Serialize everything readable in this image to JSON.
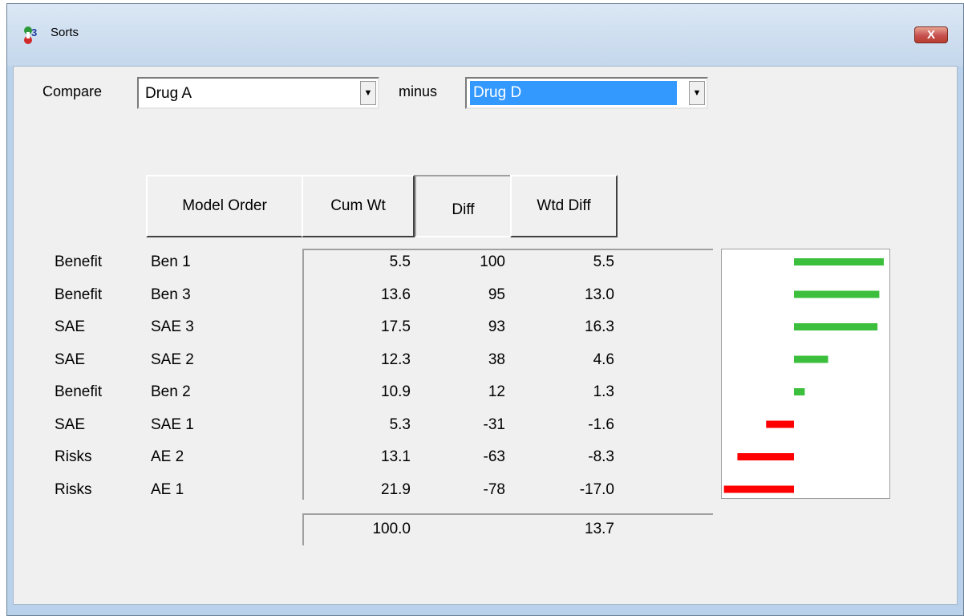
{
  "window": {
    "title": "Sorts",
    "close_glyph": "X"
  },
  "compare": {
    "label": "Compare",
    "left_value": "Drug A",
    "minus_label": "minus",
    "right_value": "Drug D",
    "dropdown_glyph": "▼"
  },
  "sort_buttons": [
    {
      "label": "Model Order",
      "state": "raised"
    },
    {
      "label": "Cum Wt",
      "state": "raised"
    },
    {
      "label": "Diff",
      "state": "pressed"
    },
    {
      "label": "Wtd Diff",
      "state": "raised"
    }
  ],
  "rows": [
    {
      "category": "Benefit",
      "name": "Ben 1",
      "cum_wt": "5.5",
      "diff": "100",
      "wtd_diff": "5.5"
    },
    {
      "category": "Benefit",
      "name": "Ben 3",
      "cum_wt": "13.6",
      "diff": "95",
      "wtd_diff": "13.0"
    },
    {
      "category": "SAE",
      "name": "SAE 3",
      "cum_wt": "17.5",
      "diff": "93",
      "wtd_diff": "16.3"
    },
    {
      "category": "SAE",
      "name": "SAE 2",
      "cum_wt": "12.3",
      "diff": "38",
      "wtd_diff": "4.6"
    },
    {
      "category": "Benefit",
      "name": "Ben 2",
      "cum_wt": "10.9",
      "diff": "12",
      "wtd_diff": "1.3"
    },
    {
      "category": "SAE",
      "name": "SAE 1",
      "cum_wt": "5.3",
      "diff": "-31",
      "wtd_diff": "-1.6"
    },
    {
      "category": "Risks",
      "name": "AE 2",
      "cum_wt": "13.1",
      "diff": "-63",
      "wtd_diff": "-8.3"
    },
    {
      "category": "Risks",
      "name": "AE 1",
      "cum_wt": "21.9",
      "diff": "-78",
      "wtd_diff": "-17.0"
    }
  ],
  "totals": {
    "cum_wt": "100.0",
    "wtd_diff": "13.7"
  },
  "chart_data": {
    "type": "bar",
    "orientation": "horizontal",
    "categories": [
      "Ben 1",
      "Ben 3",
      "SAE 3",
      "SAE 2",
      "Ben 2",
      "SAE 1",
      "AE 2",
      "AE 1"
    ],
    "values": [
      100,
      95,
      93,
      38,
      12,
      -31,
      -63,
      -78
    ],
    "positive_color": "#3cbf3c",
    "negative_color": "#ff0000",
    "xlim": [
      -80,
      100
    ]
  }
}
